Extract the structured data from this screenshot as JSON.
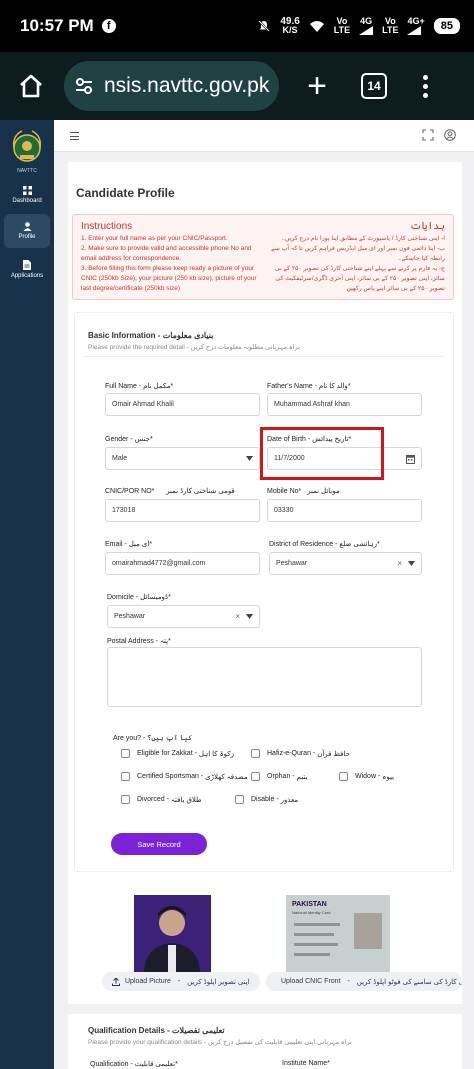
{
  "status_bar": {
    "time": "10:57 PM",
    "net_speed_value": "49.6",
    "net_speed_unit": "K/S",
    "sim1_label": "Vo",
    "sim1_sub": "LTE",
    "sim2_label": "Vo",
    "sim2_sub": "LTE",
    "signal1": "4G",
    "signal2": "4G+",
    "battery": "85"
  },
  "browser": {
    "url": "nsis.navttc.gov.pk",
    "tab_count": "14"
  },
  "rail": {
    "logo_text": "NAVTTC",
    "items": [
      {
        "label": "Dashboard",
        "icon": "grid-icon"
      },
      {
        "label": "Profile",
        "icon": "user-icon"
      },
      {
        "label": "Applications",
        "icon": "document-icon"
      }
    ]
  },
  "page": {
    "title": "Candidate Profile"
  },
  "instructions": {
    "title_en": "Instructions",
    "title_ur": "ہدایات",
    "lines_en": [
      "1. Enter your full name as per your CNIC/Passport.",
      "2. Make sure to provide valid and accessible phone No and email address for correspondence.",
      "3. Before filling this form please keep ready a picture of your CNIC (250kb Size), your picture (250 kb size), picture of your last degree/certificate (250kb size)"
    ],
    "lines_ur": [
      "ا- اپنی شناختی کارڈ / پاسپورٹ کے مطابق اپنا پورا نام درج کریں۔",
      "ب- اپنا دائمی فون نمبر اور ای میل ایڈریس فراہم کریں تا کہ آپ سے رابطہ کیا جاسکے۔",
      "ج- یہ فارم پر کرنے سے پہلے اپنے شناختی کارڈ کی تصویر ۲۵۰ کے بی سائز، اپنی تصویر ۲۵۰ کے بی سائز، اپنی آخری ڈگری/سرٹیفکیٹ کی تصویر ۲۵۰ کے بی سائز اپنے پاس رکھیں"
    ]
  },
  "basic_info": {
    "title": "Basic Information - بنیادی معلومات",
    "subtitle": "Please provide the required detail - براہ مہربانی مطلوبہ معلومات درج کریں",
    "full_name_label": "Full Name - مکمل نام",
    "full_name_value": "Omair Ahmad Khalil",
    "father_name_label": "Father's Name - والد کا نام",
    "father_name_value": "Muhammad Ashraf khan",
    "gender_label": "Gender - جنس",
    "gender_value": "Male",
    "dob_label": "Date of Birth - تاریخ پیدائش",
    "dob_value": "11/7/2000",
    "cnic_label": "CNIC/POR NO",
    "cnic_label_ur": "قومی شناختی کارڈ نمبر",
    "cnic_value": "173018",
    "mobile_label": "Mobile No",
    "mobile_label_ur": "موبائل نمبر",
    "mobile_value": "03330",
    "email_label": "Email - ای میل",
    "email_value": "omairahmad4772@gmail.com",
    "district_label": "District of Residence - رہائشی ضلع",
    "district_value": "Peshawar",
    "domicile_label": "Domicile - ڈومیسائل",
    "domicile_value": "Peshawar",
    "postal_label": "Postal Address - پتہ",
    "postal_value": ""
  },
  "are_you": {
    "label": "Are you? - کیا آپ ہیں؟",
    "options": [
      {
        "en": "Eligible for Zakkat",
        "ur": "زکوۃ کا اہل"
      },
      {
        "en": "Hafiz-e-Quran",
        "ur": "حافظ قرآن"
      },
      {
        "en": "Certified Sportsman",
        "ur": "مصدقہ کھلاڑی"
      },
      {
        "en": "Orphan",
        "ur": "یتیم"
      },
      {
        "en": "Widow",
        "ur": "بیوہ"
      },
      {
        "en": "Divorced",
        "ur": "طلاق یافتہ"
      },
      {
        "en": "Disable",
        "ur": "معذور"
      }
    ]
  },
  "actions": {
    "save": "Save Record"
  },
  "uploads": {
    "picture_btn": "Upload Picture",
    "picture_btn_ur": "اپنی تصویر اپلوڈ کریں",
    "cnic_btn": "Upload CNIC Front",
    "cnic_btn_ur": "شناختی کارڈ کی سامنے کی فوٹو اپلوڈ کریں",
    "cnic_card_text": "PAKISTAN",
    "cnic_card_sub": "National Identity Card"
  },
  "qualification": {
    "title": "Qualification Details - تعلیمی تفصیلات",
    "subtitle": "Please provide your qualification details - براہ مہربانی اپنی تعلیمی قابلیت کی تفصیل درج کریں",
    "qualification_label": "Qualification - تعلیمی قابلیت",
    "institute_label": "Institute Name"
  },
  "colors": {
    "accent": "#7a22d6",
    "instruction_red": "#c0392b",
    "highlight_red": "#d0161b",
    "rail_bg": "#17324a"
  }
}
